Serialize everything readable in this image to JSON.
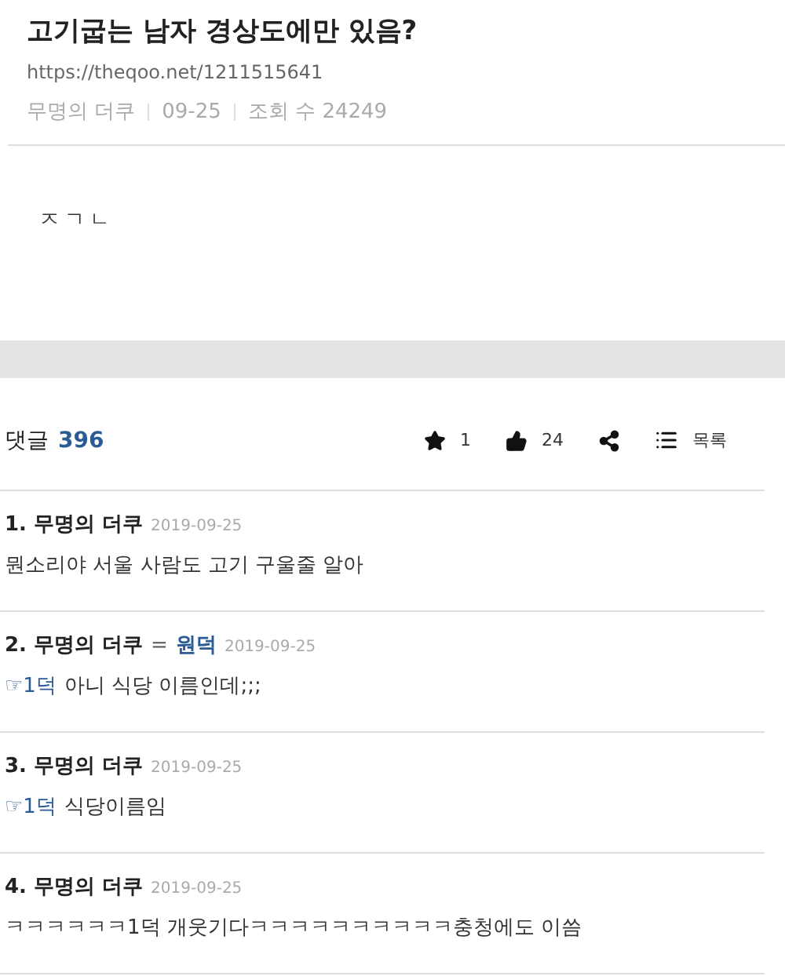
{
  "post": {
    "title": "고기굽는 남자 경상도에만 있음?",
    "url": "https://theqoo.net/1211515641",
    "author": "무명의 더쿠",
    "date": "09-25",
    "views_label": "조회 수",
    "views": "24249",
    "body": "ㅈㄱㄴ"
  },
  "comment_bar": {
    "label": "댓글",
    "count": "396",
    "stars": "1",
    "likes": "24",
    "list_label": "목록"
  },
  "comments": [
    {
      "number": "1.",
      "author": "무명의 더쿠",
      "date": "2019-09-25",
      "text": "뭔소리야 서울 사람도 고기 구울줄 알아"
    },
    {
      "number": "2.",
      "author": "무명의 더쿠",
      "op_mark": "=",
      "op_label": "원덕",
      "date": "2019-09-25",
      "reply_to": "☞1덕",
      "text": "아니 식당 이름인데;;;"
    },
    {
      "number": "3.",
      "author": "무명의 더쿠",
      "date": "2019-09-25",
      "reply_to": "☞1덕",
      "text": "식당이름임"
    },
    {
      "number": "4.",
      "author": "무명의 더쿠",
      "date": "2019-09-25",
      "text": "ㅋㅋㅋㅋㅋㅋ1덕 개웃기다ㅋㅋㅋㅋㅋㅋㅋㅋㅋㅋ충청에도 이씀"
    }
  ]
}
